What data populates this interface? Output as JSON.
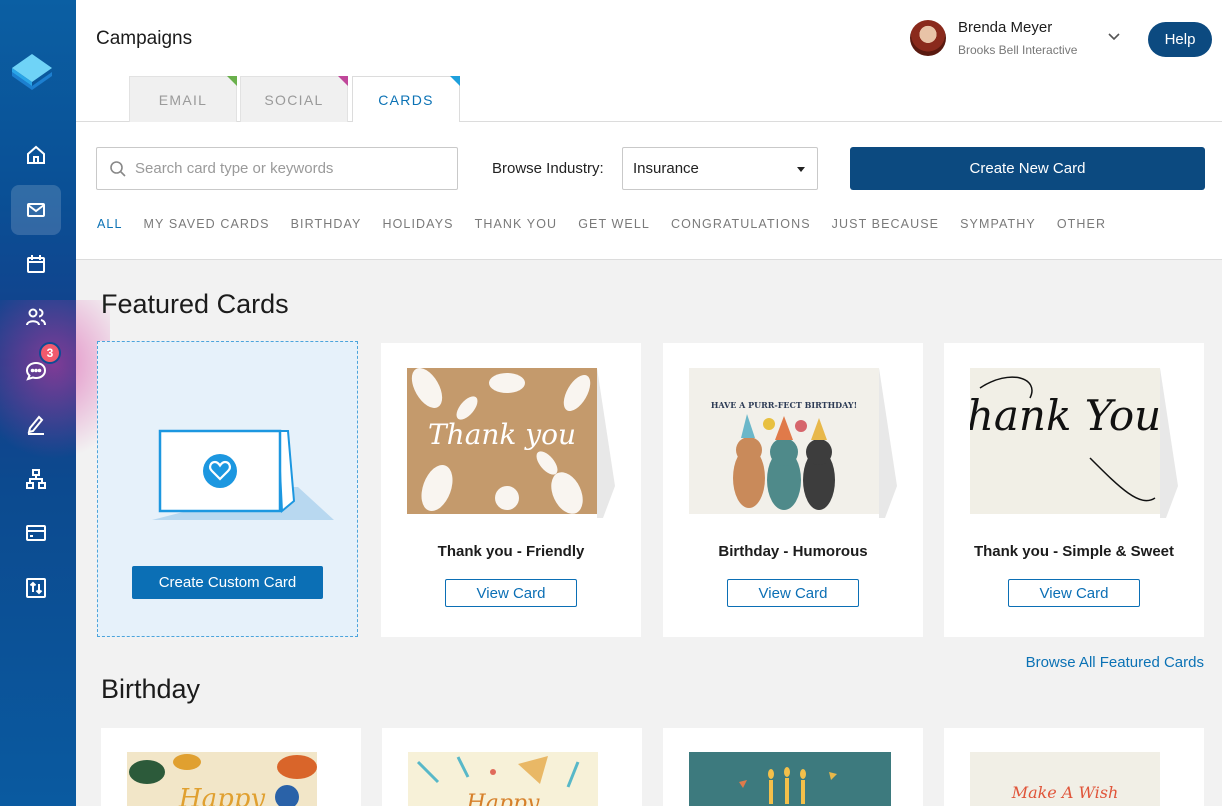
{
  "header": {
    "title": "Campaigns",
    "tabs": [
      {
        "label": "EMAIL",
        "corner_color": "#6ab04c"
      },
      {
        "label": "SOCIAL",
        "corner_color": "#c0479a"
      },
      {
        "label": "CARDS",
        "corner_color": "#1ea0dc"
      }
    ],
    "user": {
      "name": "Brenda Meyer",
      "org": "Brooks Bell Interactive"
    },
    "help_label": "Help"
  },
  "sidebar": {
    "items": [
      {
        "icon": "home-icon"
      },
      {
        "icon": "mail-icon"
      },
      {
        "icon": "calendar-icon"
      },
      {
        "icon": "users-icon"
      },
      {
        "icon": "chat-icon",
        "badge": "3"
      },
      {
        "icon": "edit-icon"
      },
      {
        "icon": "sitemap-icon"
      },
      {
        "icon": "credit-card-icon"
      },
      {
        "icon": "transfer-icon"
      }
    ]
  },
  "toolbar": {
    "search_placeholder": "Search card type or keywords",
    "browse_label": "Browse Industry:",
    "industry_value": "Insurance",
    "create_label": "Create New Card",
    "filters": [
      "ALL",
      "MY SAVED CARDS",
      "BIRTHDAY",
      "HOLIDAYS",
      "THANK YOU",
      "GET WELL",
      "CONGRATULATIONS",
      "JUST BECAUSE",
      "SYMPATHY",
      "OTHER"
    ]
  },
  "featured": {
    "title": "Featured Cards",
    "custom_button": "Create Custom Card",
    "cards": [
      {
        "title": "Thank you - Friendly",
        "button": "View Card",
        "art_text": "Thank you"
      },
      {
        "title": "Birthday - Humorous",
        "button": "View Card",
        "art_text": "HAVE A PURR-FECT BIRTHDAY!"
      },
      {
        "title": "Thank you - Simple & Sweet",
        "button": "View Card",
        "art_text": "Thank You"
      }
    ],
    "browse_all": "Browse All Featured Cards"
  },
  "birthday": {
    "title": "Birthday",
    "cards": [
      {
        "art_text": "Happy"
      },
      {
        "art_text": "Happy"
      },
      {
        "art_text": ""
      },
      {
        "art_text": "Make A Wish"
      }
    ]
  },
  "colors": {
    "primary": "#0c4a80",
    "accent": "#0b72b5",
    "badge": "#f05a6e"
  }
}
